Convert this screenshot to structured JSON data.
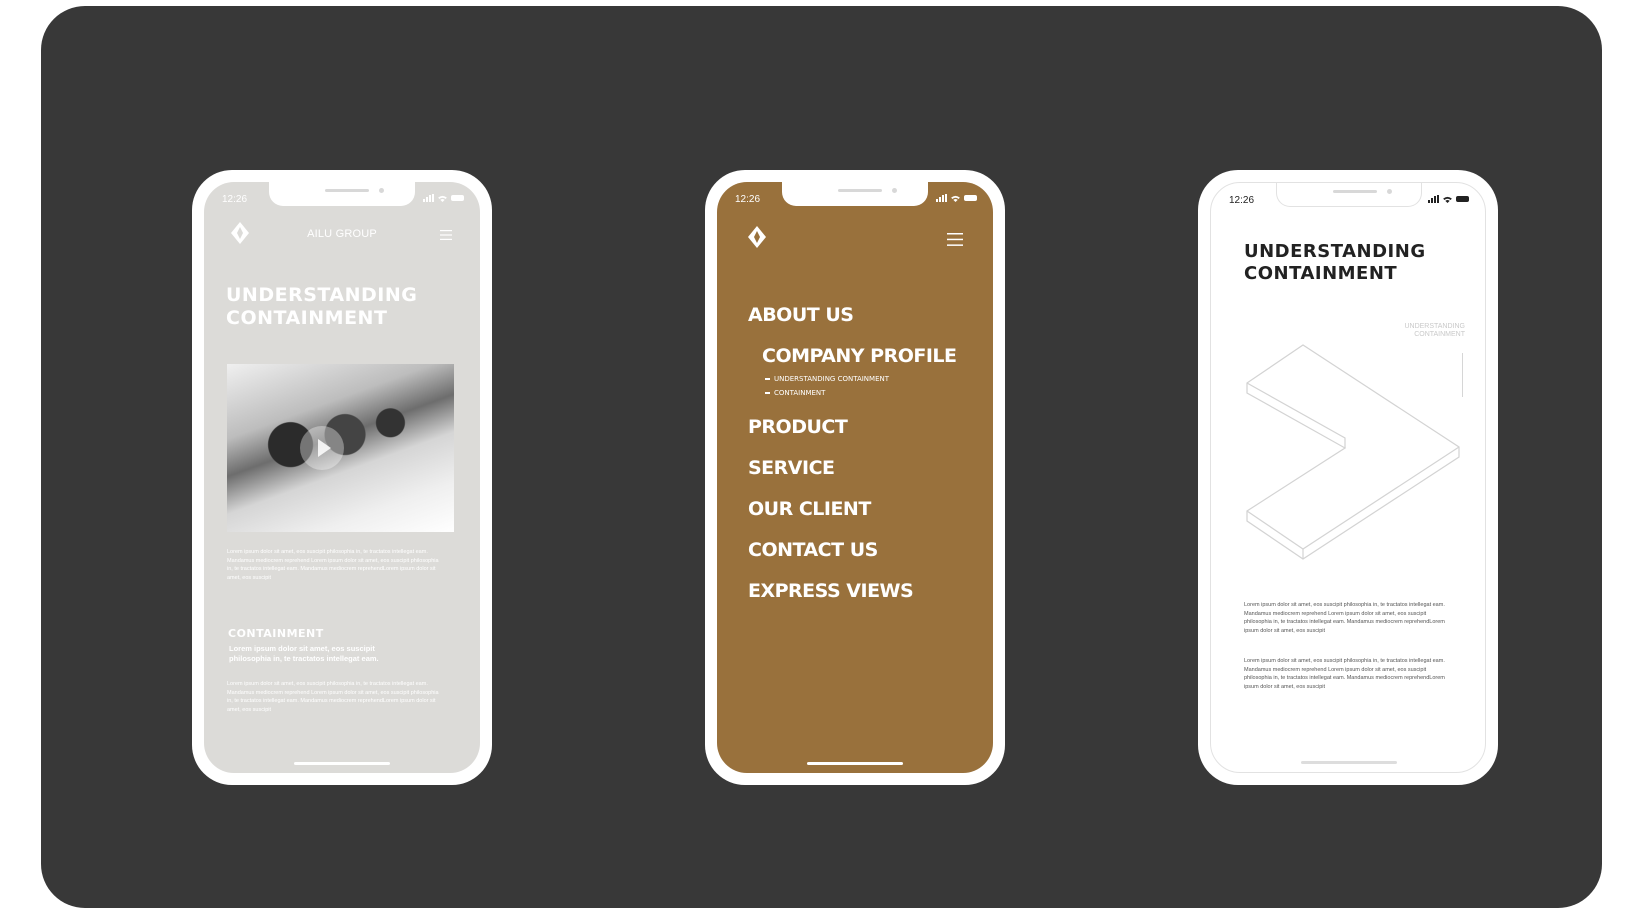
{
  "colors": {
    "board": "#383838",
    "phone_frame": "#ffffff",
    "screen_1_bg": "#dcdbd8",
    "screen_2_bg": "#99713c",
    "screen_3_bg": "#ffffff"
  },
  "icons": [
    "logo-icon",
    "hamburger-menu-icon",
    "signal-icon",
    "wifi-icon",
    "battery-icon",
    "play-icon"
  ],
  "phone1": {
    "time": "12:26",
    "brand": "AILU GROUP",
    "title_line1": "UNDERSTANDING",
    "title_line2": "CONTAINMENT",
    "body1": "Lorem ipsum dolor sit amet, eos suscipit philosophia in, te tractatos intellegat eam. Mandamus mediocrem reprehend Lorem ipsum dolor sit amet, eos suscipit philosophia in, te tractatos intellegat eam. Mandamus mediocrem reprehendLorem ipsum dolor sit amet, eos suscipit",
    "section_title": "CONTAINMENT",
    "section_lead": "Lorem ipsum dolor sit amet, eos suscipit philosophia in, te tractatos intellegat eam.",
    "body2": "Lorem ipsum dolor sit amet, eos suscipit philosophia in, te tractatos intellegat eam. Mandamus mediocrem reprehend Lorem ipsum dolor sit amet, eos suscipit philosophia in, te tractatos intellegat eam. Mandamus mediocrem reprehendLorem ipsum dolor sit amet, eos suscipit"
  },
  "phone2": {
    "time": "12:26",
    "menu": {
      "about": "ABOUT US",
      "company_profile": "COMPANY PROFILE",
      "sub1": "UNDERSTANDING CONTAINMENT",
      "sub2": "CONTAINMENT",
      "product": "PRODUCT",
      "service": "SERVICE",
      "our_client": "OUR CLIENT",
      "contact": "CONTACT US",
      "express": "EXPRESS VIEWS"
    }
  },
  "phone3": {
    "time": "12:26",
    "title_line1": "UNDERSTANDING",
    "title_line2": "CONTAINMENT",
    "side_label_line1": "UNDERSTANDING",
    "side_label_line2": "CONTAINMENT",
    "body1": "Lorem ipsum dolor sit amet, eos suscipit philosophia in, te tractatos intellegat eam. Mandamus mediocrem reprehend Lorem ipsum dolor sit amet, eos suscipit philosophia in, te tractatos intellegat eam. Mandamus mediocrem reprehendLorem ipsum dolor sit amet, eos suscipit",
    "body2": "Lorem ipsum dolor sit amet, eos suscipit philosophia in, te tractatos intellegat eam. Mandamus mediocrem reprehend Lorem ipsum dolor sit amet, eos suscipit philosophia in, te tractatos intellegat eam. Mandamus mediocrem reprehendLorem ipsum dolor sit amet, eos suscipit"
  }
}
